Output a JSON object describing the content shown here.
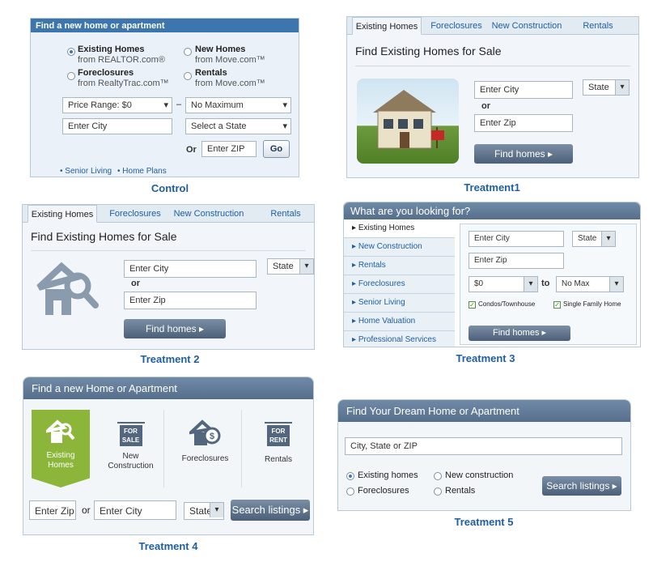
{
  "control": {
    "header": "Find a new home or apartment",
    "options": [
      {
        "title": "Existing Homes",
        "sub": "from REALTOR.com®",
        "selected": true
      },
      {
        "title": "New Homes",
        "sub": "from Move.com™",
        "selected": false
      },
      {
        "title": "Foreclosures",
        "sub": "from RealtyTrac.com™",
        "selected": false
      },
      {
        "title": "Rentals",
        "sub": "from Move.com™",
        "selected": false
      }
    ],
    "price_range": "Price Range: $0",
    "max": "No Maximum",
    "city": "Enter City",
    "state": "Select a State",
    "or": "Or",
    "zip": "Enter ZIP",
    "go": "Go",
    "links": [
      "• Senior Living",
      "• Home Plans"
    ],
    "caption": "Control"
  },
  "t1": {
    "tabs": [
      "Existing Homes",
      "Foreclosures",
      "New Construction",
      "Rentals"
    ],
    "title": "Find Existing Homes for Sale",
    "city": "Enter City",
    "state": "State",
    "or": "or",
    "zip": "Enter Zip",
    "button": "Find homes ▸",
    "caption": "Treatment1"
  },
  "t2": {
    "tabs": [
      "Existing Homes",
      "Foreclosures",
      "New Construction",
      "Rentals"
    ],
    "title": "Find Existing Homes for Sale",
    "city": "Enter City",
    "state": "State",
    "or": "or",
    "zip": "Enter Zip",
    "button": "Find homes ▸",
    "caption": "Treatment 2"
  },
  "t3": {
    "header": "What are you looking for?",
    "menu": [
      "Existing Homes",
      "New Construction",
      "Rentals",
      "Foreclosures",
      "Senior Living",
      "Home Valuation",
      "Professional Services"
    ],
    "city": "Enter City",
    "state": "State",
    "zip": "Enter Zip",
    "min": "$0",
    "to": "to",
    "max": "No Max",
    "check1": "Condos/Townhouse",
    "check2": "Single Family Home",
    "button": "Find homes ▸",
    "caption": "Treatment 3"
  },
  "t4": {
    "header": "Find a new Home or Apartment",
    "cats": [
      "Existing Homes",
      "New Construction",
      "Foreclosures",
      "Rentals"
    ],
    "sign_sale": "FOR SALE",
    "sign_rent": "FOR RENT",
    "zip": "Enter Zip",
    "or": "or",
    "city": "Enter City",
    "state": "State",
    "button": "Search listings ▸",
    "caption": "Treatment 4"
  },
  "t5": {
    "header": "Find Your Dream Home or Apartment",
    "search": "City, State or ZIP",
    "radios": [
      "Existing homes",
      "New construction",
      "Foreclosures",
      "Rentals"
    ],
    "button": "Search listings ▸",
    "caption": "Treatment 5"
  }
}
